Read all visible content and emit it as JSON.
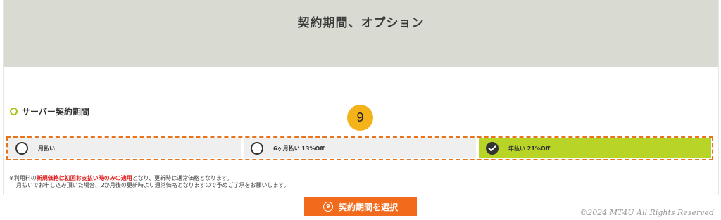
{
  "header": {
    "title": "契約期間、オプション"
  },
  "section": {
    "title": "サーバー契約期間"
  },
  "step_badge": "9",
  "options": [
    {
      "label": "月払い",
      "selected": false
    },
    {
      "label": "6ヶ月払い 13%Off",
      "selected": false
    },
    {
      "label": "年払い 21%Off",
      "selected": true
    }
  ],
  "notes": {
    "line1_prefix": "※利用料の",
    "line1_highlight": "新規価格は初回お支払い時のみの適用",
    "line1_suffix": "となり、更新時は通常価格となります。",
    "line2": "月払いでお申し込み頂いた場合、2か月後の更新時より通常価格となりますので予めご了承をお願いします。"
  },
  "action_button": {
    "number": "9",
    "label": "契約期間を選択"
  },
  "copyright": "©2024 MT4U All Rights Reserved",
  "colors": {
    "header_bg": "#d9dad2",
    "selected_bg": "#b8d426",
    "accent_orange": "#f26a1b",
    "badge_yellow": "#f4b21b",
    "highlight_red": "#e02020"
  }
}
